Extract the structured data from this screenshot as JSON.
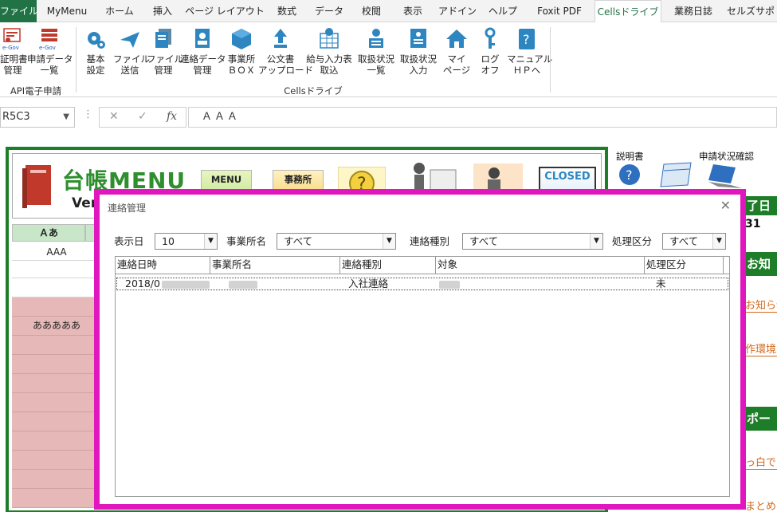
{
  "ribbon_tabs": [
    {
      "label": "ファイル"
    },
    {
      "label": "MyMenu"
    },
    {
      "label": "ホーム"
    },
    {
      "label": "挿入"
    },
    {
      "label": "ページ レイアウト"
    },
    {
      "label": "数式"
    },
    {
      "label": "データ"
    },
    {
      "label": "校閲"
    },
    {
      "label": "表示"
    },
    {
      "label": "アドイン"
    },
    {
      "label": "ヘルプ"
    },
    {
      "label": "Foxit PDF"
    },
    {
      "label": "Cellsドライブ"
    },
    {
      "label": "業務日誌"
    },
    {
      "label": "セルズサポ"
    }
  ],
  "ribbon": {
    "api_group": {
      "label": "API電子申請",
      "buttons": [
        {
          "line1": "証明書",
          "line2": "管理",
          "icon_text": "e-Gov"
        },
        {
          "line1": "申請データ",
          "line2": "一覧",
          "icon_text": "e-Gov"
        }
      ]
    },
    "cells_group": {
      "label": "Cellsドライブ",
      "buttons": [
        {
          "line1": "基本",
          "line2": "設定"
        },
        {
          "line1": "ファイル",
          "line2": "送信"
        },
        {
          "line1": "ファイル",
          "line2": "管理"
        },
        {
          "line1": "連絡データ",
          "line2": "管理"
        },
        {
          "line1": "事業所",
          "line2": "ＢＯＸ"
        },
        {
          "line1": "公文書",
          "line2": "アップロード"
        },
        {
          "line1": "給与入力表",
          "line2": "取込"
        },
        {
          "line1": "取扱状況",
          "line2": "一覧"
        },
        {
          "line1": "取扱状況",
          "line2": "入力"
        },
        {
          "line1": "マイ",
          "line2": "ページ"
        },
        {
          "line1": "ログ",
          "line2": "オフ"
        },
        {
          "line1": "マニュアル",
          "line2": "ＨＰへ"
        }
      ]
    }
  },
  "formula_bar": {
    "name_box": "R5C3",
    "value": "ＡＡＡ"
  },
  "sheet": {
    "menu_title": "台帳MENU",
    "menu_version": "Ver.",
    "header_buttons": [
      {
        "label": "MENU"
      },
      {
        "label": "事務所"
      },
      {
        "label": "CLOSED"
      }
    ],
    "column_header": "Ａあ",
    "cells": [
      "AAA",
      "あああああ"
    ],
    "right_pane": {
      "help_label": "説明書",
      "status_label": "申請状況確認",
      "green1": "了日",
      "value1": "31",
      "green2": "お知",
      "link1": "お知らせ",
      "link2": "作環境",
      "green3": "ポー",
      "link3": "っ白で",
      "link4": "まとめ"
    }
  },
  "dialog": {
    "title": "連絡管理",
    "filters": {
      "display_day_label": "表示日",
      "display_day_value": "10",
      "office_label": "事業所名",
      "office_value": "すべて",
      "contact_type_label": "連絡種別",
      "contact_type_value": "すべて",
      "status_label": "処理区分",
      "status_value": "すべて"
    },
    "columns": [
      "連絡日時",
      "事業所名",
      "連絡種別",
      "対象",
      "処理区分"
    ],
    "rows": [
      {
        "date": "2018/0",
        "office": "",
        "type": "入社連絡",
        "target": "",
        "status": "未"
      }
    ]
  }
}
